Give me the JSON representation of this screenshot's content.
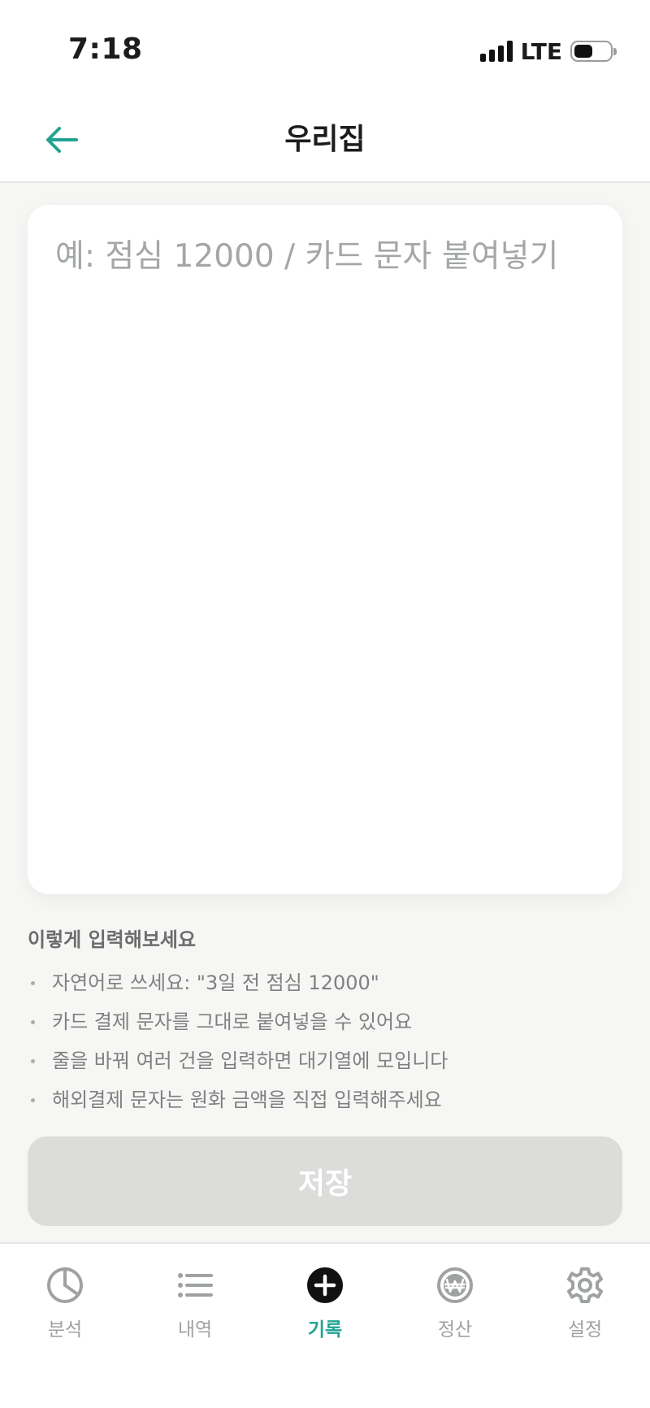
{
  "status_bar": {
    "time": "7:18",
    "network": "LTE"
  },
  "header": {
    "title": "우리집",
    "back_icon": "arrow-left-icon"
  },
  "entry": {
    "placeholder": "예: 점심 12000 / 카드 문자 붙여넣기",
    "value": ""
  },
  "tips": {
    "title": "이렇게 입력해보세요",
    "items": [
      "자연어로 쓰세요: \"3일 전 점심 12000\"",
      "카드 결제 문자를 그대로 붙여넣을 수 있어요",
      "줄을 바꿔 여러 건을 입력하면 대기열에 모입니다",
      "해외결제 문자는 원화 금액을 직접 입력해주세요"
    ]
  },
  "save_label": "저장",
  "tab_bar": {
    "tabs": [
      {
        "label": "분석",
        "icon": "pie-chart-icon",
        "active": false
      },
      {
        "label": "내역",
        "icon": "list-icon",
        "active": false
      },
      {
        "label": "기록",
        "icon": "plus-circle-icon",
        "active": true
      },
      {
        "label": "정산",
        "icon": "won-coin-icon",
        "active": false
      },
      {
        "label": "설정",
        "icon": "gear-icon",
        "active": false
      }
    ]
  },
  "colors": {
    "accent": "#22a393",
    "background": "#f6f6f4",
    "disabled_button": "#dcdddb",
    "inactive_icon": "#9ea2a0"
  }
}
